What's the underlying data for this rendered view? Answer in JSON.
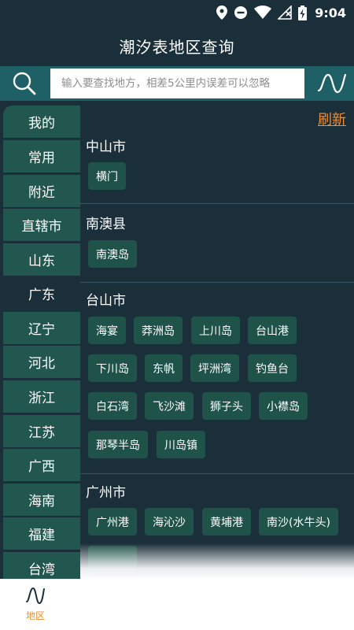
{
  "status": {
    "time": "9:04"
  },
  "header": {
    "title": "潮汐表地区查询"
  },
  "search": {
    "placeholder": "输入要查找地方，相差5公里内误差可以忽略"
  },
  "sidebar": {
    "items": [
      {
        "label": "我的"
      },
      {
        "label": "常用"
      },
      {
        "label": "附近"
      },
      {
        "label": "直辖市"
      },
      {
        "label": "山东"
      },
      {
        "label": "广东",
        "active": true
      },
      {
        "label": "辽宁"
      },
      {
        "label": "河北"
      },
      {
        "label": "浙江"
      },
      {
        "label": "江苏"
      },
      {
        "label": "广西"
      },
      {
        "label": "海南"
      },
      {
        "label": "福建"
      },
      {
        "label": "台湾"
      }
    ]
  },
  "content": {
    "refresh_label": "刷新",
    "groups": [
      {
        "name": "中山市",
        "places": [
          "横门"
        ]
      },
      {
        "name": "南澳县",
        "places": [
          "南澳岛"
        ]
      },
      {
        "name": "台山市",
        "places": [
          "海宴",
          "莽洲岛",
          "上川岛",
          "台山港",
          "下川岛",
          "东帆",
          "坪洲湾",
          "钓鱼台",
          "白石湾",
          "飞沙滩",
          "狮子头",
          "小襟岛",
          "那琴半岛",
          "川岛镇"
        ]
      },
      {
        "name": "广州市",
        "places": [
          "广州港",
          "海沁沙",
          "黄埔港",
          "南沙(水牛头)"
        ]
      }
    ]
  },
  "bottom_nav": {
    "items": [
      {
        "label": "地区",
        "icon": "wave-icon",
        "active": true
      }
    ]
  },
  "colors": {
    "background": "#1b2f3a",
    "accent": "#f08c32",
    "chip": "#1f5248",
    "sidebar": "#21574e",
    "search_bar": "#1f5f66"
  }
}
